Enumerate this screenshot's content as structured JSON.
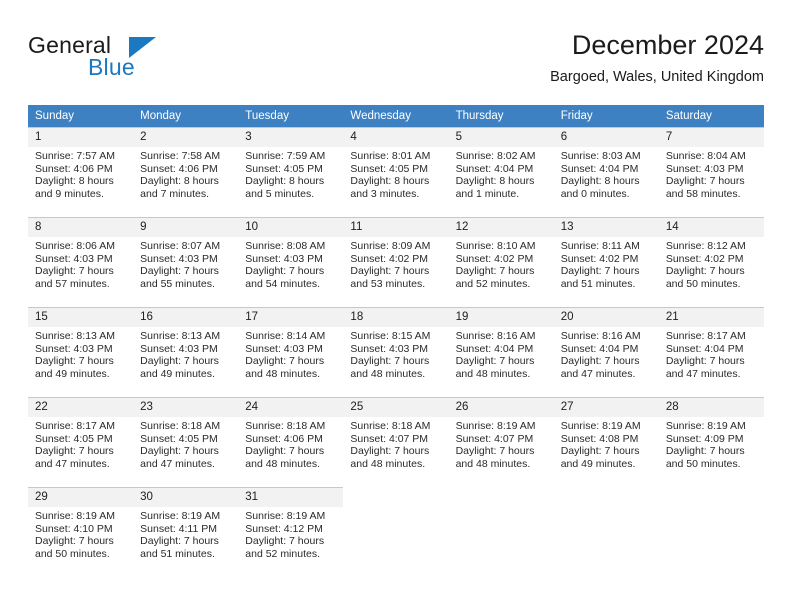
{
  "brand": {
    "name_part1": "General",
    "name_part2": "Blue",
    "accent_color": "#1c79c0",
    "triangle_icon": "triangle-icon"
  },
  "header": {
    "title": "December 2024",
    "location": "Bargoed, Wales, United Kingdom"
  },
  "calendar": {
    "header_bg": "#3d81c2",
    "daynum_bg": "#f2f2f2",
    "weekdays": [
      "Sunday",
      "Monday",
      "Tuesday",
      "Wednesday",
      "Thursday",
      "Friday",
      "Saturday"
    ],
    "weeks": [
      [
        {
          "day": "1",
          "sunrise": "Sunrise: 7:57 AM",
          "sunset": "Sunset: 4:06 PM",
          "daylight_line1": "Daylight: 8 hours",
          "daylight_line2": "and 9 minutes."
        },
        {
          "day": "2",
          "sunrise": "Sunrise: 7:58 AM",
          "sunset": "Sunset: 4:06 PM",
          "daylight_line1": "Daylight: 8 hours",
          "daylight_line2": "and 7 minutes."
        },
        {
          "day": "3",
          "sunrise": "Sunrise: 7:59 AM",
          "sunset": "Sunset: 4:05 PM",
          "daylight_line1": "Daylight: 8 hours",
          "daylight_line2": "and 5 minutes."
        },
        {
          "day": "4",
          "sunrise": "Sunrise: 8:01 AM",
          "sunset": "Sunset: 4:05 PM",
          "daylight_line1": "Daylight: 8 hours",
          "daylight_line2": "and 3 minutes."
        },
        {
          "day": "5",
          "sunrise": "Sunrise: 8:02 AM",
          "sunset": "Sunset: 4:04 PM",
          "daylight_line1": "Daylight: 8 hours",
          "daylight_line2": "and 1 minute."
        },
        {
          "day": "6",
          "sunrise": "Sunrise: 8:03 AM",
          "sunset": "Sunset: 4:04 PM",
          "daylight_line1": "Daylight: 8 hours",
          "daylight_line2": "and 0 minutes."
        },
        {
          "day": "7",
          "sunrise": "Sunrise: 8:04 AM",
          "sunset": "Sunset: 4:03 PM",
          "daylight_line1": "Daylight: 7 hours",
          "daylight_line2": "and 58 minutes."
        }
      ],
      [
        {
          "day": "8",
          "sunrise": "Sunrise: 8:06 AM",
          "sunset": "Sunset: 4:03 PM",
          "daylight_line1": "Daylight: 7 hours",
          "daylight_line2": "and 57 minutes."
        },
        {
          "day": "9",
          "sunrise": "Sunrise: 8:07 AM",
          "sunset": "Sunset: 4:03 PM",
          "daylight_line1": "Daylight: 7 hours",
          "daylight_line2": "and 55 minutes."
        },
        {
          "day": "10",
          "sunrise": "Sunrise: 8:08 AM",
          "sunset": "Sunset: 4:03 PM",
          "daylight_line1": "Daylight: 7 hours",
          "daylight_line2": "and 54 minutes."
        },
        {
          "day": "11",
          "sunrise": "Sunrise: 8:09 AM",
          "sunset": "Sunset: 4:02 PM",
          "daylight_line1": "Daylight: 7 hours",
          "daylight_line2": "and 53 minutes."
        },
        {
          "day": "12",
          "sunrise": "Sunrise: 8:10 AM",
          "sunset": "Sunset: 4:02 PM",
          "daylight_line1": "Daylight: 7 hours",
          "daylight_line2": "and 52 minutes."
        },
        {
          "day": "13",
          "sunrise": "Sunrise: 8:11 AM",
          "sunset": "Sunset: 4:02 PM",
          "daylight_line1": "Daylight: 7 hours",
          "daylight_line2": "and 51 minutes."
        },
        {
          "day": "14",
          "sunrise": "Sunrise: 8:12 AM",
          "sunset": "Sunset: 4:02 PM",
          "daylight_line1": "Daylight: 7 hours",
          "daylight_line2": "and 50 minutes."
        }
      ],
      [
        {
          "day": "15",
          "sunrise": "Sunrise: 8:13 AM",
          "sunset": "Sunset: 4:03 PM",
          "daylight_line1": "Daylight: 7 hours",
          "daylight_line2": "and 49 minutes."
        },
        {
          "day": "16",
          "sunrise": "Sunrise: 8:13 AM",
          "sunset": "Sunset: 4:03 PM",
          "daylight_line1": "Daylight: 7 hours",
          "daylight_line2": "and 49 minutes."
        },
        {
          "day": "17",
          "sunrise": "Sunrise: 8:14 AM",
          "sunset": "Sunset: 4:03 PM",
          "daylight_line1": "Daylight: 7 hours",
          "daylight_line2": "and 48 minutes."
        },
        {
          "day": "18",
          "sunrise": "Sunrise: 8:15 AM",
          "sunset": "Sunset: 4:03 PM",
          "daylight_line1": "Daylight: 7 hours",
          "daylight_line2": "and 48 minutes."
        },
        {
          "day": "19",
          "sunrise": "Sunrise: 8:16 AM",
          "sunset": "Sunset: 4:04 PM",
          "daylight_line1": "Daylight: 7 hours",
          "daylight_line2": "and 48 minutes."
        },
        {
          "day": "20",
          "sunrise": "Sunrise: 8:16 AM",
          "sunset": "Sunset: 4:04 PM",
          "daylight_line1": "Daylight: 7 hours",
          "daylight_line2": "and 47 minutes."
        },
        {
          "day": "21",
          "sunrise": "Sunrise: 8:17 AM",
          "sunset": "Sunset: 4:04 PM",
          "daylight_line1": "Daylight: 7 hours",
          "daylight_line2": "and 47 minutes."
        }
      ],
      [
        {
          "day": "22",
          "sunrise": "Sunrise: 8:17 AM",
          "sunset": "Sunset: 4:05 PM",
          "daylight_line1": "Daylight: 7 hours",
          "daylight_line2": "and 47 minutes."
        },
        {
          "day": "23",
          "sunrise": "Sunrise: 8:18 AM",
          "sunset": "Sunset: 4:05 PM",
          "daylight_line1": "Daylight: 7 hours",
          "daylight_line2": "and 47 minutes."
        },
        {
          "day": "24",
          "sunrise": "Sunrise: 8:18 AM",
          "sunset": "Sunset: 4:06 PM",
          "daylight_line1": "Daylight: 7 hours",
          "daylight_line2": "and 48 minutes."
        },
        {
          "day": "25",
          "sunrise": "Sunrise: 8:18 AM",
          "sunset": "Sunset: 4:07 PM",
          "daylight_line1": "Daylight: 7 hours",
          "daylight_line2": "and 48 minutes."
        },
        {
          "day": "26",
          "sunrise": "Sunrise: 8:19 AM",
          "sunset": "Sunset: 4:07 PM",
          "daylight_line1": "Daylight: 7 hours",
          "daylight_line2": "and 48 minutes."
        },
        {
          "day": "27",
          "sunrise": "Sunrise: 8:19 AM",
          "sunset": "Sunset: 4:08 PM",
          "daylight_line1": "Daylight: 7 hours",
          "daylight_line2": "and 49 minutes."
        },
        {
          "day": "28",
          "sunrise": "Sunrise: 8:19 AM",
          "sunset": "Sunset: 4:09 PM",
          "daylight_line1": "Daylight: 7 hours",
          "daylight_line2": "and 50 minutes."
        }
      ],
      [
        {
          "day": "29",
          "sunrise": "Sunrise: 8:19 AM",
          "sunset": "Sunset: 4:10 PM",
          "daylight_line1": "Daylight: 7 hours",
          "daylight_line2": "and 50 minutes."
        },
        {
          "day": "30",
          "sunrise": "Sunrise: 8:19 AM",
          "sunset": "Sunset: 4:11 PM",
          "daylight_line1": "Daylight: 7 hours",
          "daylight_line2": "and 51 minutes."
        },
        {
          "day": "31",
          "sunrise": "Sunrise: 8:19 AM",
          "sunset": "Sunset: 4:12 PM",
          "daylight_line1": "Daylight: 7 hours",
          "daylight_line2": "and 52 minutes."
        },
        {
          "day": "",
          "sunrise": "",
          "sunset": "",
          "daylight_line1": "",
          "daylight_line2": ""
        },
        {
          "day": "",
          "sunrise": "",
          "sunset": "",
          "daylight_line1": "",
          "daylight_line2": ""
        },
        {
          "day": "",
          "sunrise": "",
          "sunset": "",
          "daylight_line1": "",
          "daylight_line2": ""
        },
        {
          "day": "",
          "sunrise": "",
          "sunset": "",
          "daylight_line1": "",
          "daylight_line2": ""
        }
      ]
    ]
  }
}
